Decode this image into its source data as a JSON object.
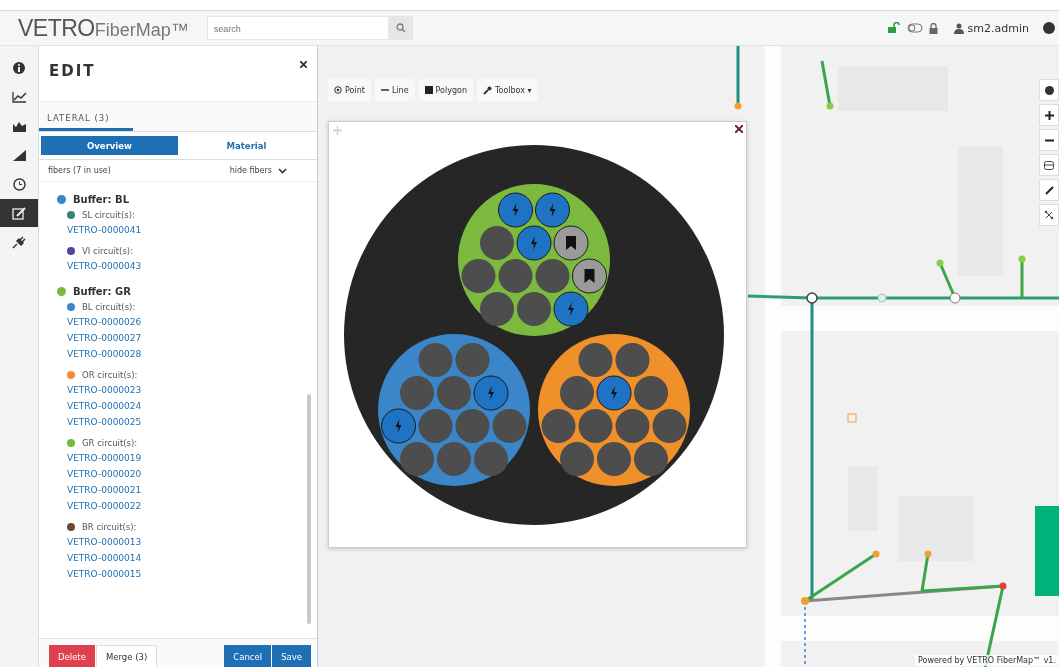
{
  "header": {
    "logo_main": "VETRO",
    "logo_sub": "FiberMap™",
    "search": {
      "placeholder": "search"
    },
    "user": "sm2.admin"
  },
  "rail": [
    {
      "kind": "info",
      "selected": false
    },
    {
      "kind": "line-chart",
      "selected": false
    },
    {
      "kind": "area-chart",
      "selected": false
    },
    {
      "kind": "signal",
      "selected": false
    },
    {
      "kind": "clock",
      "selected": false
    },
    {
      "kind": "edit",
      "selected": true
    },
    {
      "kind": "plug",
      "selected": false
    }
  ],
  "panel": {
    "title": "EDIT",
    "tab": {
      "label": "LATERAL (3)",
      "selected": true
    },
    "segments": [
      {
        "label": "Overview",
        "selected": true
      },
      {
        "label": "Material",
        "selected": false
      }
    ],
    "fibers_label": "fibers (7 in use)",
    "toggle": "hide fibers",
    "buffers": [
      {
        "name": "Buffer: BL",
        "color": "#3a86c8",
        "circuits": [
          {
            "label": "SL circuit(s):",
            "color": "#3f7f78",
            "ids": [
              "VETRO-0000041"
            ]
          },
          {
            "label": "VI circuit(s):",
            "color": "#5a3fa0",
            "ids": [
              "VETRO-0000043"
            ]
          }
        ]
      },
      {
        "name": "Buffer: GR",
        "color": "#7cba3f",
        "circuits": [
          {
            "label": "BL circuit(s):",
            "color": "#3a86c8",
            "ids": [
              "VETRO-0000026",
              "VETRO-0000027",
              "VETRO-0000028"
            ]
          },
          {
            "label": "OR circuit(s):",
            "color": "#f0902a",
            "ids": [
              "VETRO-0000023",
              "VETRO-0000024",
              "VETRO-0000025"
            ]
          },
          {
            "label": "GR circuit(s):",
            "color": "#6cbb3c",
            "ids": [
              "VETRO-0000019",
              "VETRO-0000020",
              "VETRO-0000021",
              "VETRO-0000022"
            ]
          },
          {
            "label": "BR circuit(s):",
            "color": "#6b4a35",
            "ids": [
              "VETRO-0000013",
              "VETRO-0000014",
              "VETRO-0000015"
            ]
          }
        ]
      }
    ],
    "buttons": [
      {
        "label": "Delete",
        "kind": "danger"
      },
      {
        "label": "Merge (3)",
        "kind": "plain"
      },
      {
        "label": "Cancel",
        "kind": "primary"
      },
      {
        "label": "Save",
        "kind": "primary"
      }
    ]
  },
  "map_toolbar": [
    {
      "label": "Point",
      "kind": "point"
    },
    {
      "label": "Line",
      "kind": "line"
    },
    {
      "label": "Polygon",
      "kind": "polygon"
    },
    {
      "label": "Toolbox ▾",
      "kind": "toolbox"
    }
  ],
  "cross_section": {
    "buffers": [
      {
        "color": "#7cba3f",
        "fibers": [
          {
            "kind": "lit"
          },
          {
            "kind": "lit"
          },
          {
            "kind": "dark"
          },
          {
            "kind": "lit"
          },
          {
            "kind": "reserved"
          },
          {
            "kind": "dark"
          },
          {
            "kind": "dark"
          },
          {
            "kind": "dark"
          },
          {
            "kind": "reserved"
          },
          {
            "kind": "dark"
          },
          {
            "kind": "dark"
          },
          {
            "kind": "lit"
          }
        ]
      },
      {
        "color": "#3a86c8",
        "fibers": [
          {
            "kind": "dark"
          },
          {
            "kind": "dark"
          },
          {
            "kind": "dark"
          },
          {
            "kind": "dark"
          },
          {
            "kind": "lit"
          },
          {
            "kind": "lit"
          },
          {
            "kind": "dark"
          },
          {
            "kind": "dark"
          },
          {
            "kind": "dark"
          },
          {
            "kind": "dark"
          },
          {
            "kind": "dark"
          },
          {
            "kind": "dark"
          }
        ]
      },
      {
        "color": "#f0902a",
        "fibers": [
          {
            "kind": "dark"
          },
          {
            "kind": "dark"
          },
          {
            "kind": "dark"
          },
          {
            "kind": "lit"
          },
          {
            "kind": "dark"
          },
          {
            "kind": "dark"
          },
          {
            "kind": "dark"
          },
          {
            "kind": "dark"
          },
          {
            "kind": "dark"
          },
          {
            "kind": "dark"
          },
          {
            "kind": "dark"
          },
          {
            "kind": "dark"
          }
        ]
      }
    ]
  },
  "map_controls": [
    {
      "kind": "layers"
    },
    {
      "kind": "zoom-in"
    },
    {
      "kind": "zoom-out"
    },
    {
      "kind": "select"
    },
    {
      "kind": "draw"
    },
    {
      "kind": "network"
    }
  ],
  "attribution": "Powered by VETRO FiberMap™ v1."
}
